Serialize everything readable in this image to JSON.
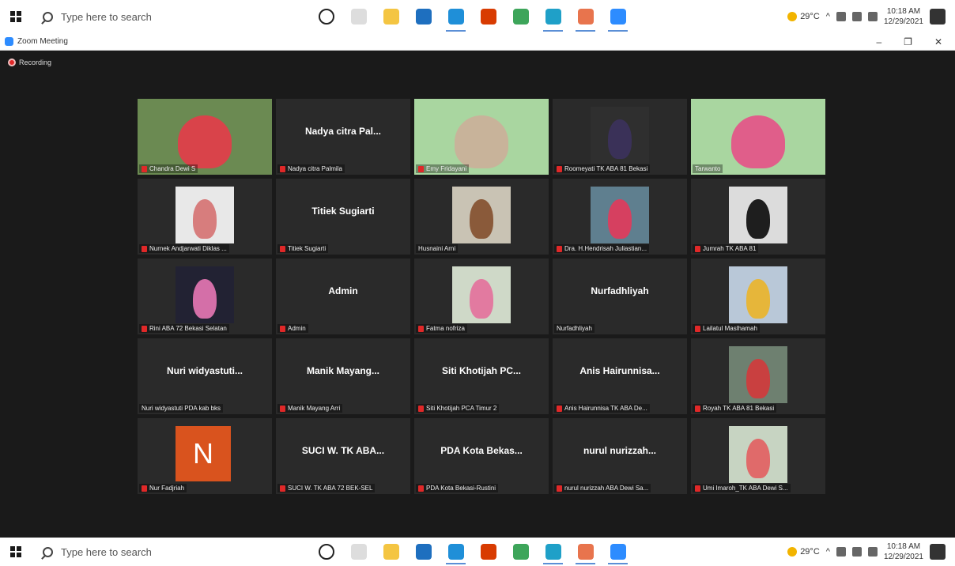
{
  "taskbar": {
    "search_placeholder": "Type here to search",
    "apps": [
      {
        "icon": "cortana-icon",
        "color": "#ffffff",
        "border": "#222222",
        "active": false
      },
      {
        "icon": "task-view-icon",
        "color": "#dddddd",
        "active": false
      },
      {
        "icon": "file-explorer-icon",
        "color": "#f4c542",
        "active": false
      },
      {
        "icon": "store-icon",
        "color": "#1e6fbf",
        "active": false
      },
      {
        "icon": "telegram-icon",
        "color": "#1f8fd8",
        "active": true
      },
      {
        "icon": "office-icon",
        "color": "#d83b01",
        "active": false
      },
      {
        "icon": "chrome-icon",
        "color": "#3da55a",
        "active": false
      },
      {
        "icon": "edge-icon",
        "color": "#1fa0c8",
        "active": true
      },
      {
        "icon": "powerpoint-icon",
        "color": "#e8744d",
        "active": true
      },
      {
        "icon": "zoom-icon",
        "color": "#2d8cff",
        "active": true
      }
    ],
    "weather": "29°C",
    "time": "10:18 AM",
    "date": "12/29/2021"
  },
  "window": {
    "title": "Zoom Meeting",
    "minimize": "–",
    "restore": "❐",
    "close": "✕"
  },
  "recording_label": "Recording",
  "colors": {
    "mute": "#e02828",
    "speaker_outline": "#e2e23a",
    "tile_bg": "#2a2a2a",
    "stage_bg": "#1a1a1a"
  },
  "tiles": [
    {
      "caption": "Chandra Dewi S",
      "big": "",
      "muted": true,
      "video": true,
      "bg": "#6b8a52",
      "face": "#d9434a"
    },
    {
      "caption": "Nadya citra Palmila",
      "big": "Nadya citra Pal...",
      "muted": true,
      "video": false
    },
    {
      "caption": "Emy Fridayani",
      "big": "",
      "muted": true,
      "video": true,
      "bg": "#a9d6a0",
      "face": "#c8b39a"
    },
    {
      "caption": "Roomeyati TK ABA 81 Bekasi",
      "big": "",
      "muted": true,
      "video": true,
      "bg": "#2f2f2f",
      "face": "#3a3158"
    },
    {
      "caption": "Tarwanto",
      "big": "",
      "muted": false,
      "video": true,
      "bg": "#a9d6a0",
      "face": "#e05e8a",
      "speaker": true
    },
    {
      "caption": "Nurnek Andjarwati Diklas ...",
      "big": "",
      "muted": true,
      "video": true,
      "bg": "#e8e8e8",
      "face": "#d77d7d"
    },
    {
      "caption": "Titiek Sugiarti",
      "big": "Titiek Sugiarti",
      "muted": true,
      "video": false
    },
    {
      "caption": "Husnaini Arni",
      "big": "",
      "muted": false,
      "video": true,
      "bg": "#c9c3b4",
      "face": "#8a5a3a"
    },
    {
      "caption": "Dra. H.Hendrisah Juliastian...",
      "big": "",
      "muted": true,
      "video": true,
      "bg": "#5f7f8f",
      "face": "#d64060"
    },
    {
      "caption": "Jumrah TK ABA 81",
      "big": "",
      "muted": true,
      "video": true,
      "bg": "#dcdcdc",
      "face": "#1e1e1e"
    },
    {
      "caption": "Rini ABA 72 Bekasi Selatan",
      "big": "",
      "muted": true,
      "video": true,
      "bg": "#222233",
      "face": "#d46fa8"
    },
    {
      "caption": "Admin",
      "big": "Admin",
      "muted": true,
      "video": false
    },
    {
      "caption": "Fatma nofriza",
      "big": "",
      "muted": true,
      "video": true,
      "bg": "#cfd9c8",
      "face": "#e27aa0"
    },
    {
      "caption": "Nurfadhliyah",
      "big": "Nurfadhliyah",
      "muted": false,
      "video": false
    },
    {
      "caption": "Lailatul Maslhamah",
      "big": "",
      "muted": true,
      "video": true,
      "bg": "#b9c8d8",
      "face": "#e6b63a"
    },
    {
      "caption": "Nuri widyastuti PDA kab bks",
      "big": "Nuri widyastuti...",
      "muted": false,
      "video": false
    },
    {
      "caption": "Manik Mayang Arri",
      "big": "Manik Mayang...",
      "muted": true,
      "video": false
    },
    {
      "caption": "Siti Khotijah PCA Timur 2",
      "big": "Siti Khotijah PC...",
      "muted": true,
      "video": false
    },
    {
      "caption": "Anis Hairunnisa TK ABA De...",
      "big": "Anis Hairunnisa...",
      "muted": true,
      "video": false
    },
    {
      "caption": "Royah TK ABA 81 Bekasi",
      "big": "",
      "muted": true,
      "video": true,
      "bg": "#6e8070",
      "face": "#c94040"
    },
    {
      "caption": "Nur Fadjriah",
      "big": "",
      "muted": true,
      "video": false,
      "letter": "N"
    },
    {
      "caption": "SUCI W. TK ABA 72 BEK-SEL",
      "big": "SUCI W. TK ABA...",
      "muted": true,
      "video": false
    },
    {
      "caption": "PDA Kota Bekasi-Rustini",
      "big": "PDA Kota Bekas...",
      "muted": true,
      "video": false
    },
    {
      "caption": "nurul nurizzah ABA Dewi Sa...",
      "big": "nurul nurizzah...",
      "muted": true,
      "video": false
    },
    {
      "caption": "Umi Imaroh_TK ABA Dewi S...",
      "big": "",
      "muted": true,
      "video": true,
      "bg": "#c7d4c2",
      "face": "#e06a6a"
    }
  ]
}
